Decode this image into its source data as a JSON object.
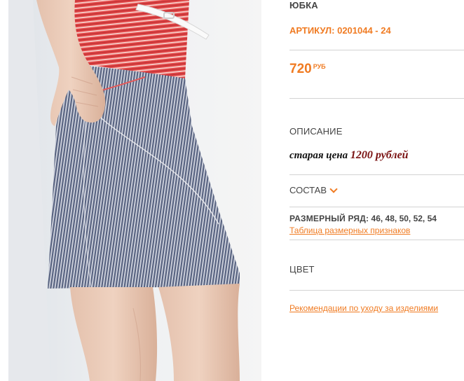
{
  "product": {
    "title": "ЮБКА",
    "sku": "АРТИКУЛ: 0201044 - 24",
    "price": {
      "amount": "720",
      "currency": "РУБ"
    },
    "description": {
      "heading": "ОПИСАНИЕ",
      "old_price_text": "старая цена",
      "old_price_value": "1200 рублей"
    },
    "composition": {
      "label": "СОСТАВ"
    },
    "sizes": {
      "label": "РАЗМЕРНЫЙ РЯД:",
      "values": "46, 48, 50, 52, 54",
      "size_table_link": "Таблица размерных признаков"
    },
    "color": {
      "heading": "ЦВЕТ"
    },
    "care_link": "Рекомендации по уходу за изделиями"
  },
  "colors": {
    "accent": "#f07b22",
    "text": "#444444",
    "old_price_value": "#7a1212",
    "divider": "#d3d3d3"
  },
  "photo": {
    "subject": "model wearing blue-white striped pencil skirt with red striped top and white belt"
  }
}
